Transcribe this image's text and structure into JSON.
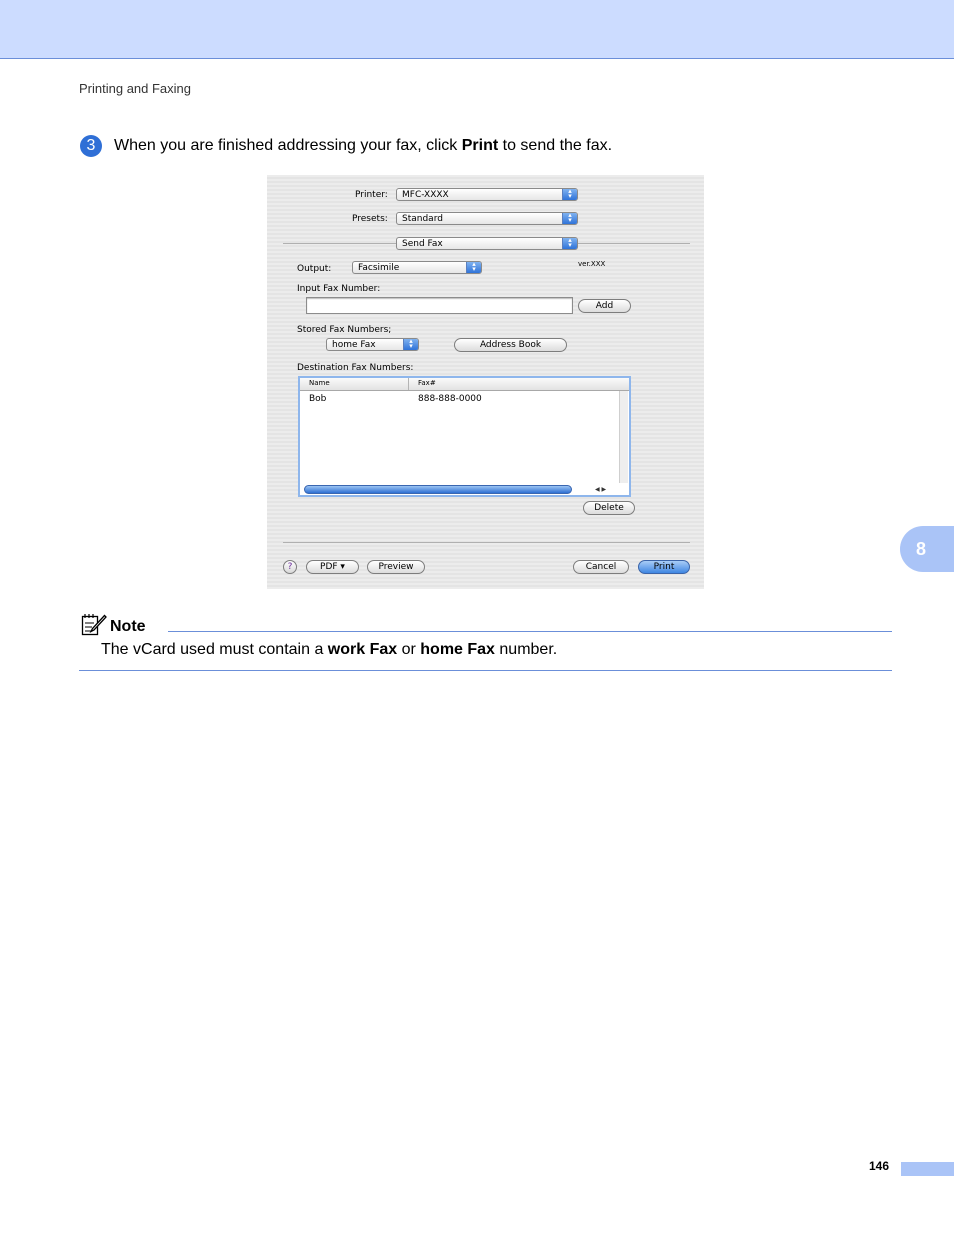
{
  "header": {
    "running_title": "Printing and Faxing"
  },
  "step": {
    "number": "3",
    "text_before": "When you are finished addressing your fax, click ",
    "text_bold": "Print",
    "text_after": " to send the fax."
  },
  "dialog": {
    "printer_label": "Printer:",
    "printer_value": "MFC-XXXX",
    "presets_label": "Presets:",
    "presets_value": "Standard",
    "panel_value": "Send Fax",
    "output_label": "Output:",
    "output_value": "Facsimile",
    "version_text": "ver.XXX",
    "input_fax_label": "Input Fax Number:",
    "input_fax_value": "",
    "add_button": "Add",
    "stored_label": "Stored Fax Numbers;",
    "stored_value": "home Fax",
    "address_book_button": "Address Book",
    "destination_label": "Destination Fax Numbers:",
    "table": {
      "columns": [
        "Name",
        "Fax#"
      ],
      "rows": [
        {
          "name": "Bob",
          "fax": "888-888-0000"
        }
      ]
    },
    "delete_button": "Delete",
    "help_button": "?",
    "pdf_button": "PDF ▾",
    "preview_button": "Preview",
    "cancel_button": "Cancel",
    "print_button": "Print"
  },
  "chapter_tab": "8",
  "note": {
    "title": "Note",
    "text_1": "The vCard used must contain a ",
    "bold_1": "work Fax",
    "text_2": " or ",
    "bold_2": "home Fax",
    "text_3": " number."
  },
  "footer": {
    "page_number": "146"
  },
  "colors": {
    "accent": "#ccdcff",
    "rule": "#6b8fd9",
    "tab": "#aac4f7",
    "step_badge": "#2f6fd6"
  }
}
